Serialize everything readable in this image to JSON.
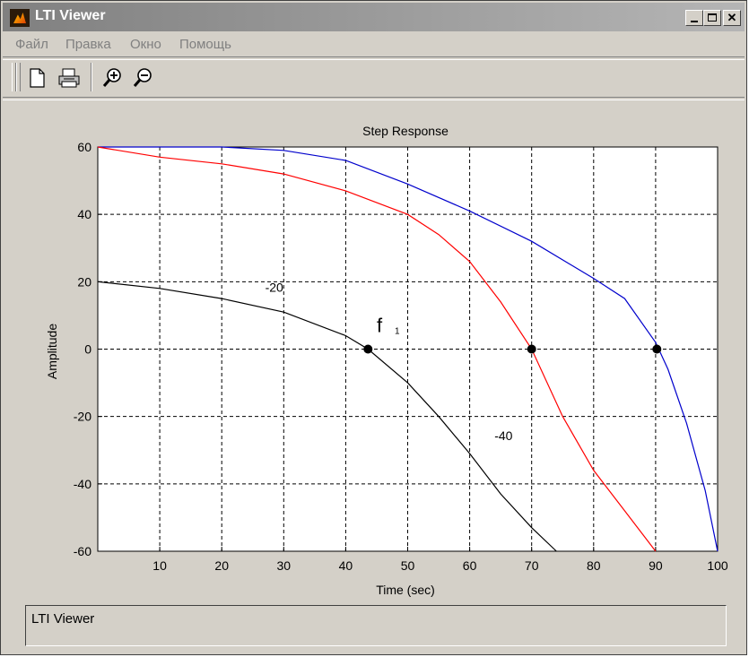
{
  "window": {
    "title": "LTI Viewer"
  },
  "menu": [
    "Файл",
    "Правка",
    "Окно",
    "Помощь"
  ],
  "toolbar": {
    "icons": [
      "new-file-icon",
      "print-icon",
      "zoom-in-icon",
      "zoom-out-icon"
    ]
  },
  "status": {
    "text": "LTI Viewer"
  },
  "chart_data": {
    "type": "line",
    "title": "Step Response",
    "xlabel": "Time (sec)",
    "ylabel": "Amplitude",
    "xlim": [
      0,
      100
    ],
    "ylim": [
      -60,
      60
    ],
    "xticks": [
      10,
      20,
      30,
      40,
      50,
      60,
      70,
      80,
      90,
      100
    ],
    "yticks": [
      -60,
      -40,
      -20,
      0,
      20,
      40,
      60
    ],
    "grid": true,
    "series": [
      {
        "color": "#0000cc",
        "points": [
          [
            0,
            60
          ],
          [
            10,
            60
          ],
          [
            20,
            60
          ],
          [
            30,
            59
          ],
          [
            40,
            56
          ],
          [
            50,
            49
          ],
          [
            60,
            41
          ],
          [
            70,
            32
          ],
          [
            80,
            21
          ],
          [
            85,
            15
          ],
          [
            90,
            2
          ],
          [
            92,
            -6
          ],
          [
            95,
            -22
          ],
          [
            98,
            -42
          ],
          [
            100,
            -60
          ]
        ]
      },
      {
        "color": "#ff0000",
        "points": [
          [
            0,
            60
          ],
          [
            10,
            57
          ],
          [
            20,
            55
          ],
          [
            30,
            52
          ],
          [
            40,
            47
          ],
          [
            50,
            40
          ],
          [
            55,
            34
          ],
          [
            60,
            26
          ],
          [
            65,
            14
          ],
          [
            70,
            0
          ],
          [
            75,
            -20
          ],
          [
            80,
            -36
          ],
          [
            85,
            -48
          ],
          [
            90,
            -60
          ]
        ]
      },
      {
        "color": "#000000",
        "points": [
          [
            0,
            20
          ],
          [
            10,
            18
          ],
          [
            20,
            15
          ],
          [
            30,
            11
          ],
          [
            40,
            4
          ],
          [
            43.6,
            0
          ],
          [
            50,
            -10
          ],
          [
            55,
            -20
          ],
          [
            60,
            -31
          ],
          [
            65,
            -43
          ],
          [
            70,
            -53
          ],
          [
            74,
            -60
          ]
        ]
      }
    ],
    "markers": [
      [
        43.6,
        0
      ],
      [
        70,
        0
      ],
      [
        90.2,
        0
      ]
    ],
    "annotations": [
      {
        "text": "-20",
        "x": 27,
        "y": 17
      },
      {
        "text": "-40",
        "x": 64,
        "y": -27
      }
    ],
    "marker_label": {
      "text": "f",
      "subscript": "1",
      "x": 45,
      "y": 5
    }
  }
}
